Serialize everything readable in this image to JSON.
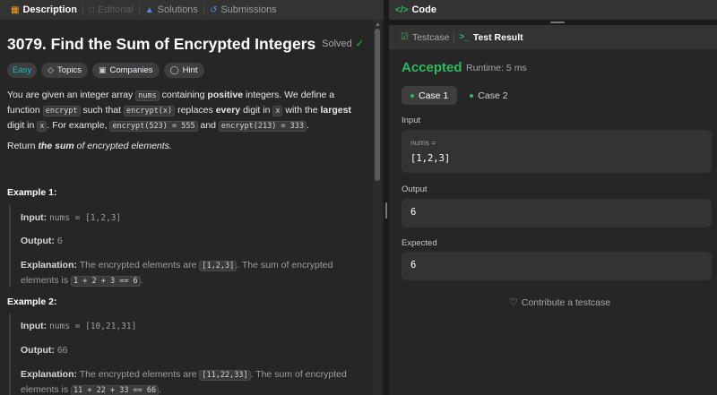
{
  "left_tabs": [
    {
      "label": "Description",
      "icon": "description-icon"
    },
    {
      "label": "Editorial",
      "icon": "editorial-icon"
    },
    {
      "label": "Solutions",
      "icon": "solutions-icon"
    },
    {
      "label": "Submissions",
      "icon": "submissions-icon"
    }
  ],
  "problem": {
    "title": "3079. Find the Sum of Encrypted Integers",
    "status": "Solved",
    "tags": [
      "Easy",
      "Topics",
      "Companies",
      "Hint"
    ],
    "description": {
      "p1_a": "You are given an integer array ",
      "p1_code1": "nums",
      "p1_b": " containing ",
      "p1_bold1": "positive",
      "p1_c": " integers. We define a function ",
      "p1_code2": "encrypt",
      "p1_d": " such that ",
      "p1_code3": "encrypt(x)",
      "p1_e": " replaces ",
      "p1_bold2": "every",
      "p1_f": " digit in ",
      "p1_code4": "x",
      "p1_g": " with the ",
      "p1_bold3": "largest",
      "p1_h": " digit in ",
      "p1_code5": "x",
      "p1_i": ". For example, ",
      "p1_code6": "encrypt(523) = 555",
      "p1_j": " and ",
      "p1_code7": "encrypt(213) = 333",
      "p1_k": ".",
      "p2_a": "Return ",
      "p2_b": "the ",
      "p2_bold": "sum",
      "p2_c": " of encrypted elements."
    },
    "examples": [
      {
        "title": "Example 1:",
        "input_label": "Input:",
        "input": "nums = [1,2,3]",
        "output_label": "Output:",
        "output": "6",
        "explanation_label": "Explanation:",
        "explanation_a": " The encrypted elements are ",
        "explanation_code1": "[1,2,3]",
        "explanation_b": ". The sum of encrypted elements is",
        "explanation_code2": "1 + 2 + 3 == 6",
        "explanation_c": "."
      },
      {
        "title": "Example 2:",
        "input_label": "Input:",
        "input": "nums = [10,21,31]",
        "output_label": "Output:",
        "output": "66",
        "explanation_label": "Explanation:",
        "explanation_a": " The encrypted elements are ",
        "explanation_code1": "[11,22,33]",
        "explanation_b": ". The sum of encrypted elements",
        "explanation_pre2": "is ",
        "explanation_code2": "11 + 22 + 33 == 66",
        "explanation_c": "."
      }
    ]
  },
  "code_bar": {
    "label": "Code",
    "icon": "code-icon"
  },
  "result_tabs": [
    {
      "label": "Testcase",
      "icon": "checkbox-icon"
    },
    {
      "label": "Test Result",
      "icon": "terminal-icon"
    }
  ],
  "result": {
    "verdict": "Accepted",
    "runtime": "Runtime: 5 ms",
    "cases": [
      "Case 1",
      "Case 2"
    ],
    "input_label": "Input",
    "input_var": "nums =",
    "input_value": "[1,2,3]",
    "output_label": "Output",
    "output_value": "6",
    "expected_label": "Expected",
    "expected_value": "6",
    "contribute": "Contribute a testcase"
  },
  "colors": {
    "accent_green": "#2cbb5d",
    "easy_teal": "#1cbaba",
    "panel_bg": "#262626",
    "tab_bar_bg": "#333333"
  }
}
